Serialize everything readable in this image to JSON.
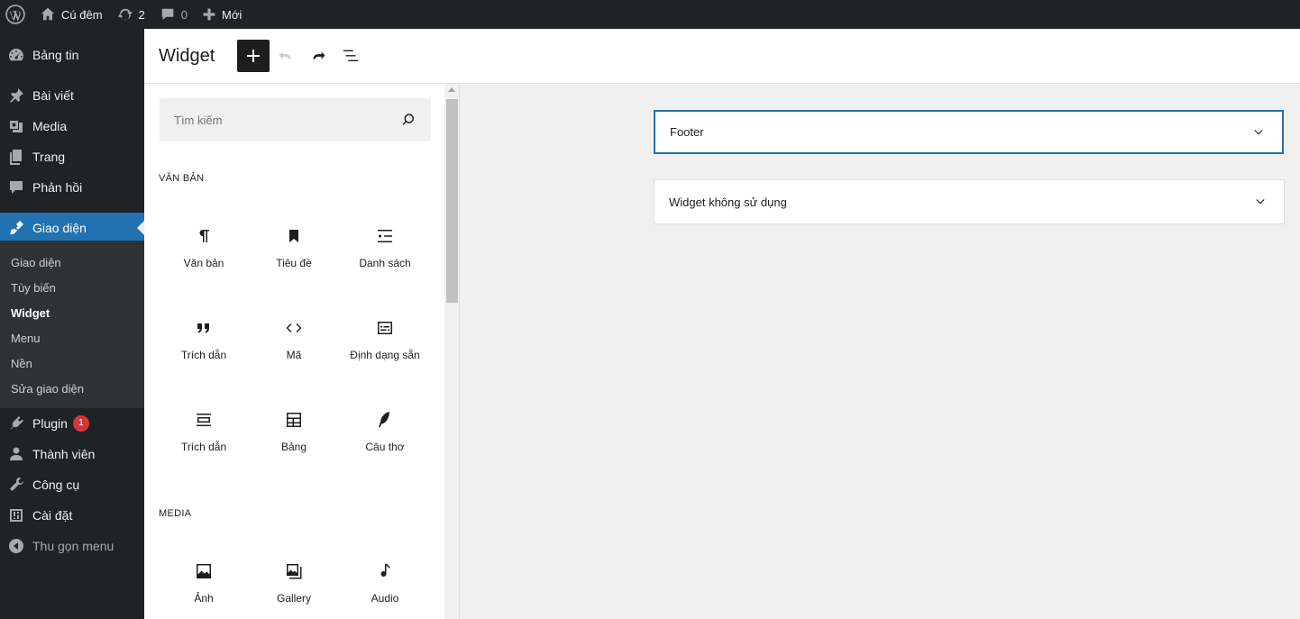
{
  "adminbar": {
    "site_name": "Cú đêm",
    "updates_count": "2",
    "comments_count": "0",
    "new_label": "Mới"
  },
  "sidebar": {
    "items": [
      {
        "label": "Bảng tin",
        "icon": "dashboard-icon"
      },
      {
        "label": "Bài viết",
        "icon": "pin-icon"
      },
      {
        "label": "Media",
        "icon": "media-icon"
      },
      {
        "label": "Trang",
        "icon": "page-icon"
      },
      {
        "label": "Phản hồi",
        "icon": "comment-icon"
      },
      {
        "label": "Giao diện",
        "icon": "appearance-icon",
        "current": true
      },
      {
        "label": "Plugin",
        "icon": "plugin-icon",
        "badge": "1"
      },
      {
        "label": "Thành viên",
        "icon": "user-icon"
      },
      {
        "label": "Công cụ",
        "icon": "wrench-icon"
      },
      {
        "label": "Cài đặt",
        "icon": "settings-icon"
      }
    ],
    "submenu": [
      "Giao diện",
      "Tùy biến",
      "Widget",
      "Menu",
      "Nền",
      "Sửa giao diện"
    ],
    "submenu_current": "Widget",
    "collapse_label": "Thu gọn menu"
  },
  "header": {
    "title": "Widget"
  },
  "inserter": {
    "search_placeholder": "Tìm kiếm",
    "categories": [
      {
        "title": "Văn bản",
        "blocks": [
          {
            "label": "Văn bản",
            "icon": "paragraph-icon"
          },
          {
            "label": "Tiêu đề",
            "icon": "bookmark-icon"
          },
          {
            "label": "Danh sách",
            "icon": "list-icon"
          },
          {
            "label": "Trích dẫn",
            "icon": "quote-icon"
          },
          {
            "label": "Mã",
            "icon": "code-icon"
          },
          {
            "label": "Định dạng sẵn",
            "icon": "preformatted-icon"
          },
          {
            "label": "Trích dẫn",
            "icon": "pullquote-icon"
          },
          {
            "label": "Bảng",
            "icon": "table-icon"
          },
          {
            "label": "Câu thơ",
            "icon": "verse-icon"
          }
        ]
      },
      {
        "title": "Media",
        "blocks": [
          {
            "label": "Ảnh",
            "icon": "image-icon"
          },
          {
            "label": "Gallery",
            "icon": "gallery-icon"
          },
          {
            "label": "Audio",
            "icon": "audio-icon"
          }
        ]
      }
    ]
  },
  "widget_areas": [
    {
      "label": "Footer",
      "selected": true
    },
    {
      "label": "Widget không sử dụng",
      "selected": false
    }
  ],
  "colors": {
    "admin_bg": "#1d2327",
    "accent": "#2271b1",
    "badge": "#d63638",
    "canvas_bg": "#f0f0f1"
  }
}
